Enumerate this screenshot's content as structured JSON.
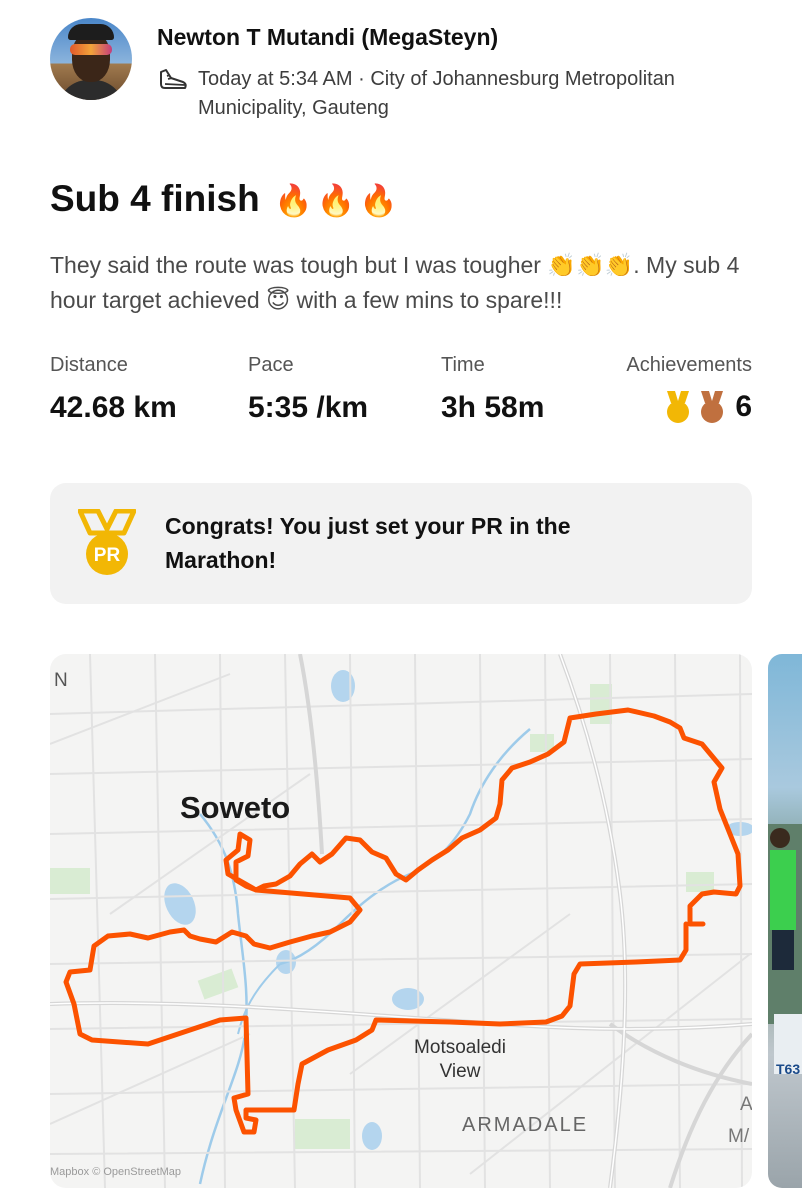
{
  "header": {
    "athlete_name": "Newton T Mutandi (MegaSteyn)",
    "meta": "Today at 5:34 AM · City of Johannesburg Metropolitan Municipality, Gauteng",
    "activity_icon": "running-shoe-icon"
  },
  "activity": {
    "title": "Sub 4 finish",
    "title_emoji": [
      "🔥",
      "🔥",
      "🔥"
    ],
    "description": "They said the route was tough but I was tougher 👏👏👏. My sub 4 hour target achieved 😇 with a few mins to spare!!!"
  },
  "stats": [
    {
      "label": "Distance",
      "value": "42.68 km"
    },
    {
      "label": "Pace",
      "value": "5:35 /km"
    },
    {
      "label": "Time",
      "value": "3h 58m"
    }
  ],
  "achievements": {
    "label": "Achievements",
    "count": "6",
    "icons": [
      "gold-medal-icon",
      "bronze-medal-icon"
    ]
  },
  "pr_card": {
    "badge_text": "PR",
    "message": "Congrats! You just set your PR in the Marathon!"
  },
  "map": {
    "labels": {
      "north": "N",
      "soweto": "Soweto",
      "motsoaledi_1": "Motsoaledi",
      "motsoaledi_2": "View",
      "armadale": "ARMADALE",
      "edge_a": "A",
      "edge_ma": "M/"
    },
    "attribution": "Mapbox © OpenStreetMap",
    "route_color": "#fc5200"
  },
  "colors": {
    "accent": "#fc5200",
    "gold": "#f2b705",
    "bronze": "#c0703f",
    "card_bg": "#f2f2f2"
  }
}
